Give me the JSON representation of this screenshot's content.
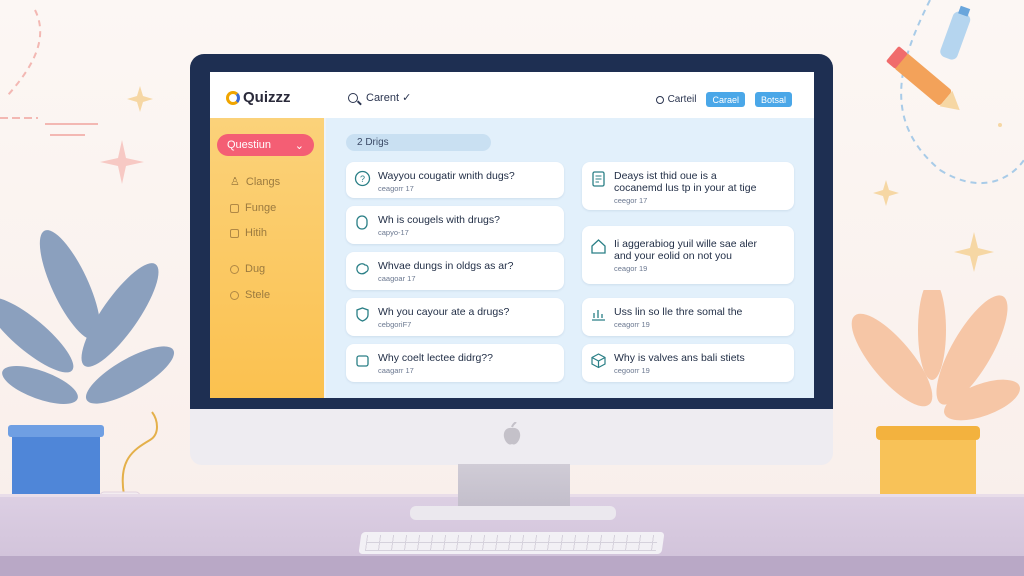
{
  "app": {
    "logo_text": "Quizzz",
    "brand_colors": {
      "logo_q": "#f0a500",
      "accent_blue": "#4aa7e8",
      "accent_pink": "#f45e74",
      "sidebar": "#fbc14f"
    }
  },
  "topbar": {
    "search_text": "Carent ✓",
    "cancel_label": "Carteil",
    "btn_primary": "Carael",
    "btn_secondary": "Botsal"
  },
  "sidebar": {
    "select_label": "Questiun",
    "select_icon": "chevron-down-icon",
    "items": [
      {
        "label": "Clangs",
        "icon": "user-icon"
      },
      {
        "label": "Funge",
        "icon": "folder-icon"
      },
      {
        "label": "Hitih",
        "icon": "grid-icon"
      },
      {
        "label": "Dug",
        "icon": "clock-icon"
      },
      {
        "label": "Stele",
        "icon": "gear-icon"
      }
    ]
  },
  "main": {
    "count_label": "2 Drigs",
    "cards_left": [
      {
        "title": "Wayyou cougatir wnith dugs?",
        "sub": "ceagorr 17",
        "icon": "question-icon"
      },
      {
        "title": "Wh is cougels with drugs?",
        "sub": "capyo-17",
        "icon": "pill-icon"
      },
      {
        "title": "Whvae dungs in oldgs as ar?",
        "sub": "caagoar 17",
        "icon": "brain-icon"
      },
      {
        "title": "Wh you cayour ate a drugs?",
        "sub": "cebgoriF7",
        "icon": "shield-icon"
      },
      {
        "title": "Why coelt lectee didrg??",
        "sub": "caagarr 17",
        "icon": "box-icon"
      }
    ],
    "cards_right": [
      {
        "title": "Deays ist thid oue is a",
        "title2": "cocanemd lus tp in your at tige",
        "sub": "ceegor 17",
        "icon": "document-icon"
      },
      {
        "title": "Ii aggerabiog yuil wille sae aler",
        "title2": "and your eolid on not you",
        "sub": "ceagor 19",
        "icon": "house-icon"
      },
      {
        "title": "Uss lin so lle thre somal the",
        "title2": "",
        "sub": "ceagorr 19",
        "icon": "chart-icon"
      },
      {
        "title": "Why is valves ans bali stiets",
        "title2": "",
        "sub": "cegoorr 19",
        "icon": "cube-icon"
      }
    ]
  }
}
